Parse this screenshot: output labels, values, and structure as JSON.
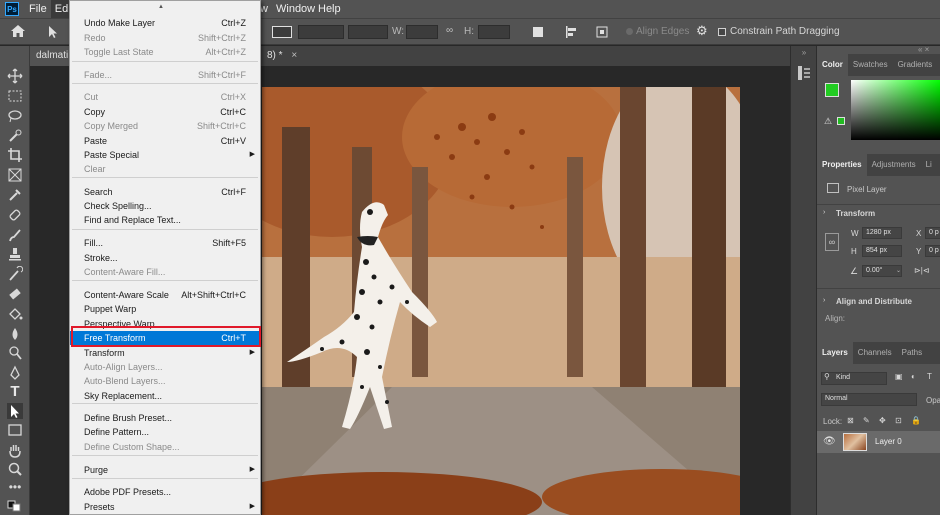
{
  "menubar": {
    "items": [
      "File",
      "Edit",
      "w",
      "Help",
      "Window"
    ]
  },
  "options_bar": {
    "w_label": "W:",
    "h_label": "H:",
    "align_edges": "Align Edges",
    "constrain": "Constrain Path Dragging"
  },
  "document": {
    "tab_title": "dalmati",
    "tab_suffix": "8) *",
    "close": "×"
  },
  "edit_menu": {
    "items": [
      {
        "label": "Undo Make Layer",
        "shortcut": "Ctrl+Z",
        "state": "enabled"
      },
      {
        "label": "Redo",
        "shortcut": "Shift+Ctrl+Z",
        "state": "disabled"
      },
      {
        "label": "Toggle Last State",
        "shortcut": "Alt+Ctrl+Z",
        "state": "disabled"
      },
      {
        "label": "Fade...",
        "shortcut": "Shift+Ctrl+F",
        "state": "disabled"
      },
      {
        "label": "Cut",
        "shortcut": "Ctrl+X",
        "state": "disabled"
      },
      {
        "label": "Copy",
        "shortcut": "Ctrl+C",
        "state": "enabled"
      },
      {
        "label": "Copy Merged",
        "shortcut": "Shift+Ctrl+C",
        "state": "disabled"
      },
      {
        "label": "Paste",
        "shortcut": "Ctrl+V",
        "state": "enabled"
      },
      {
        "label": "Paste Special",
        "shortcut": "",
        "state": "enabled",
        "submenu": true
      },
      {
        "label": "Clear",
        "shortcut": "",
        "state": "disabled"
      },
      {
        "label": "Search",
        "shortcut": "Ctrl+F",
        "state": "enabled"
      },
      {
        "label": "Check Spelling...",
        "shortcut": "",
        "state": "enabled"
      },
      {
        "label": "Find and Replace Text...",
        "shortcut": "",
        "state": "enabled"
      },
      {
        "label": "Fill...",
        "shortcut": "Shift+F5",
        "state": "enabled"
      },
      {
        "label": "Stroke...",
        "shortcut": "",
        "state": "enabled"
      },
      {
        "label": "Content-Aware Fill...",
        "shortcut": "",
        "state": "disabled"
      },
      {
        "label": "Content-Aware Scale",
        "shortcut": "Alt+Shift+Ctrl+C",
        "state": "enabled"
      },
      {
        "label": "Puppet Warp",
        "shortcut": "",
        "state": "enabled"
      },
      {
        "label": "Perspective Warp",
        "shortcut": "",
        "state": "enabled"
      },
      {
        "label": "Free Transform",
        "shortcut": "Ctrl+T",
        "state": "highlighted"
      },
      {
        "label": "Transform",
        "shortcut": "",
        "state": "enabled",
        "submenu": true
      },
      {
        "label": "Auto-Align Layers...",
        "shortcut": "",
        "state": "disabled"
      },
      {
        "label": "Auto-Blend Layers...",
        "shortcut": "",
        "state": "disabled"
      },
      {
        "label": "Sky Replacement...",
        "shortcut": "",
        "state": "enabled"
      },
      {
        "label": "Define Brush Preset...",
        "shortcut": "",
        "state": "enabled"
      },
      {
        "label": "Define Pattern...",
        "shortcut": "",
        "state": "enabled"
      },
      {
        "label": "Define Custom Shape...",
        "shortcut": "",
        "state": "disabled"
      },
      {
        "label": "Purge",
        "shortcut": "",
        "state": "enabled",
        "submenu": true
      },
      {
        "label": "Adobe PDF Presets...",
        "shortcut": "",
        "state": "enabled"
      },
      {
        "label": "Presets",
        "shortcut": "",
        "state": "enabled",
        "submenu": true
      }
    ]
  },
  "color_panel": {
    "tabs": [
      "Color",
      "Swatches",
      "Gradients"
    ],
    "foreground": "#22cc22",
    "background": "#33ee33"
  },
  "properties_panel": {
    "tabs": [
      "Properties",
      "Adjustments",
      "Li"
    ],
    "layer_type": "Pixel Layer",
    "transform_title": "Transform",
    "w_label": "W",
    "w_value": "1280 px",
    "h_label": "H",
    "h_value": "854 px",
    "x_label": "X",
    "x_value": "0 p",
    "y_label": "Y",
    "y_value": "0 p",
    "angle": "0.00°",
    "align_title": "Align and Distribute",
    "align_label": "Align:"
  },
  "layers_panel": {
    "tabs": [
      "Layers",
      "Channels",
      "Paths"
    ],
    "filter": "Kind",
    "blend_mode": "Normal",
    "opacity_label": "Opac",
    "lock_label": "Lock:",
    "layer_name": "Layer 0"
  }
}
